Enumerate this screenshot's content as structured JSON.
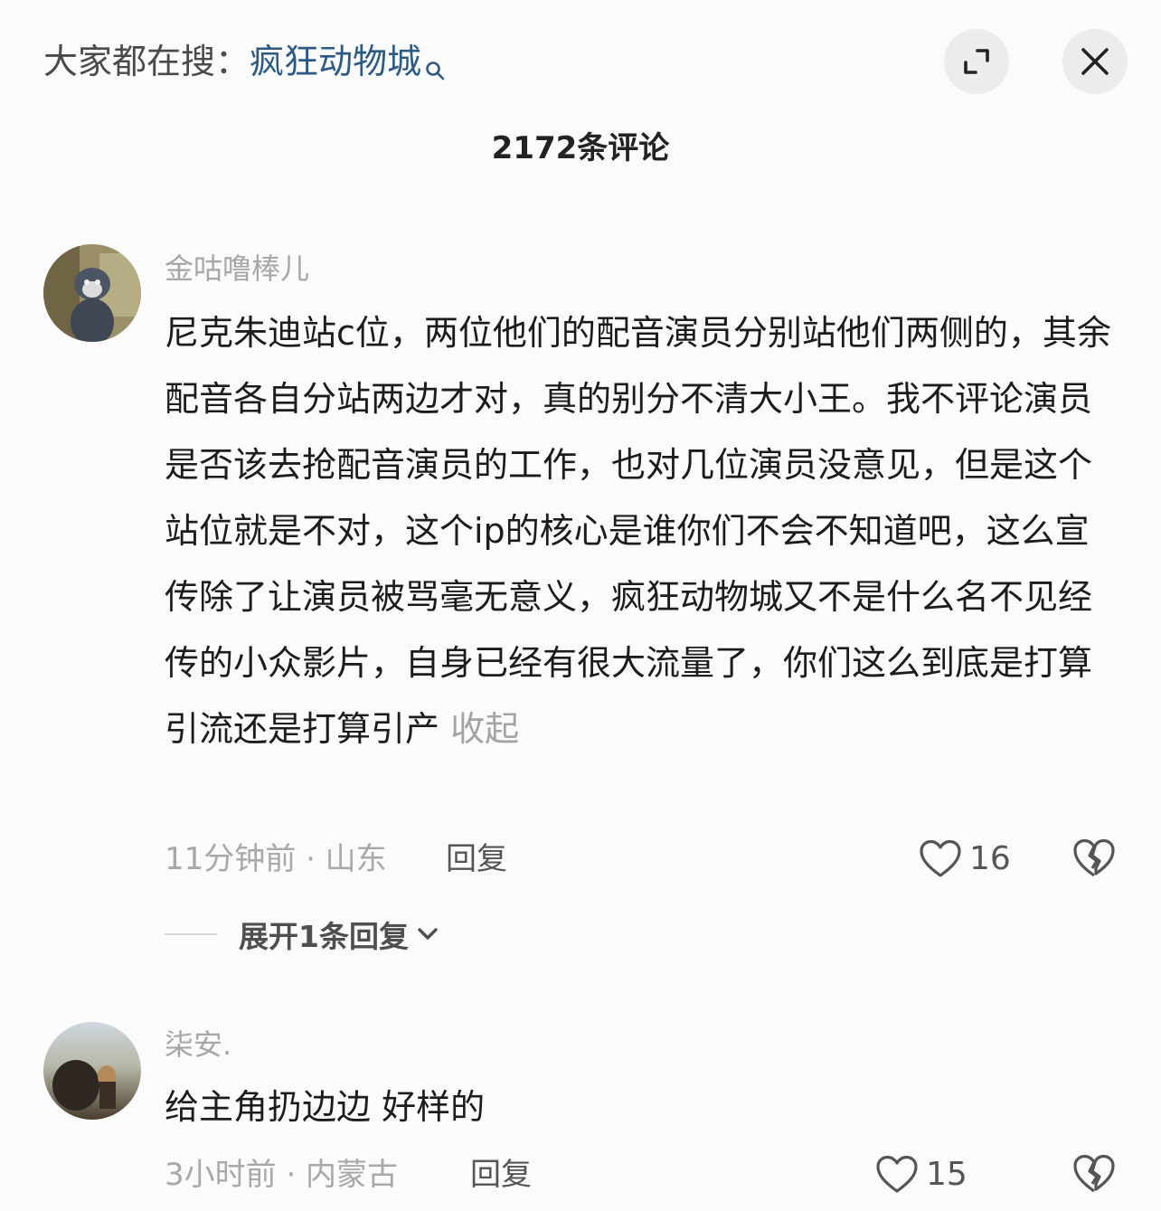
{
  "header": {
    "search_prefix": "大家都在搜：",
    "search_term": "疯狂动物城",
    "search_icon": "search-icon",
    "expand_icon": "expand-corners-icon",
    "close_icon": "close-icon"
  },
  "comment_count": "2172条评论",
  "comments": [
    {
      "username": "金咕噜棒儿",
      "text": "尼克朱迪站c位，两位他们的配音演员分别站他们两侧的，其余配音各自分站两边才对，真的别分不清大小王。我不评论演员是否该去抢配音演员的工作，也对几位演员没意见，但是这个站位就是不对，这个ip的核心是谁你们不会不知道吧，这么宣传除了让演员被骂毫无意义，疯狂动物城又不是什么名不见经传的小众影片，自身已经有很大流量了，你们这么到底是打算引流还是打算引产",
      "collapse_label": "收起",
      "meta": "11分钟前 · 山东",
      "reply_label": "回复",
      "likes": "16",
      "expand_replies_label": "展开1条回复"
    },
    {
      "username": "柒安.",
      "text": "给主角扔边边 好样的",
      "meta": "3小时前 · 内蒙古",
      "reply_label": "回复",
      "likes": "15"
    }
  ],
  "colors": {
    "search_term": "#2c5a86",
    "muted_text": "#a8a8a8",
    "button_bg": "#ececec"
  }
}
